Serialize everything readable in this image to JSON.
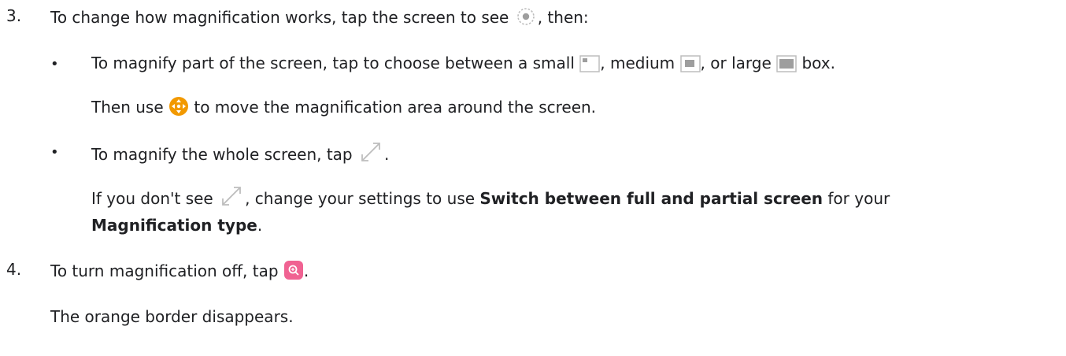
{
  "steps": [
    {
      "number": "3.",
      "intro": {
        "before": "To change how magnification works, tap the screen to see ",
        "icon": "settings-icon",
        "after": ", then:"
      },
      "bullets": [
        {
          "bullet": "•",
          "parts": {
            "p1": "To magnify part of the screen, tap to choose between a small ",
            "p2": ", medium ",
            "p3": ", or large ",
            "p4": " box."
          },
          "icons": [
            "small-box-icon",
            "medium-box-icon",
            "large-box-icon"
          ],
          "followup": {
            "before": "Then use ",
            "icon": "move-icon",
            "after": " to move the magnification area around the screen."
          }
        },
        {
          "bullet": "•",
          "parts": {
            "p1": "To magnify the whole screen, tap ",
            "p2": "."
          },
          "icons": [
            "expand-icon"
          ],
          "followup": {
            "before": "If you don't see ",
            "icon": "expand-icon",
            "mid": ", change your settings to use ",
            "bold1": "Switch between full and partial screen",
            "mid2": " for your",
            "bold2": "Magnification type",
            "end": "."
          }
        }
      ]
    },
    {
      "number": "4.",
      "intro": {
        "before": "To turn magnification off, tap ",
        "icon": "magnify-off-icon",
        "after": "."
      },
      "followup": "The orange border disappears."
    }
  ],
  "colors": {
    "text": "#202124",
    "orange": "#f29900",
    "pink": "#f06292",
    "icon_grey": "#9e9e9e"
  }
}
